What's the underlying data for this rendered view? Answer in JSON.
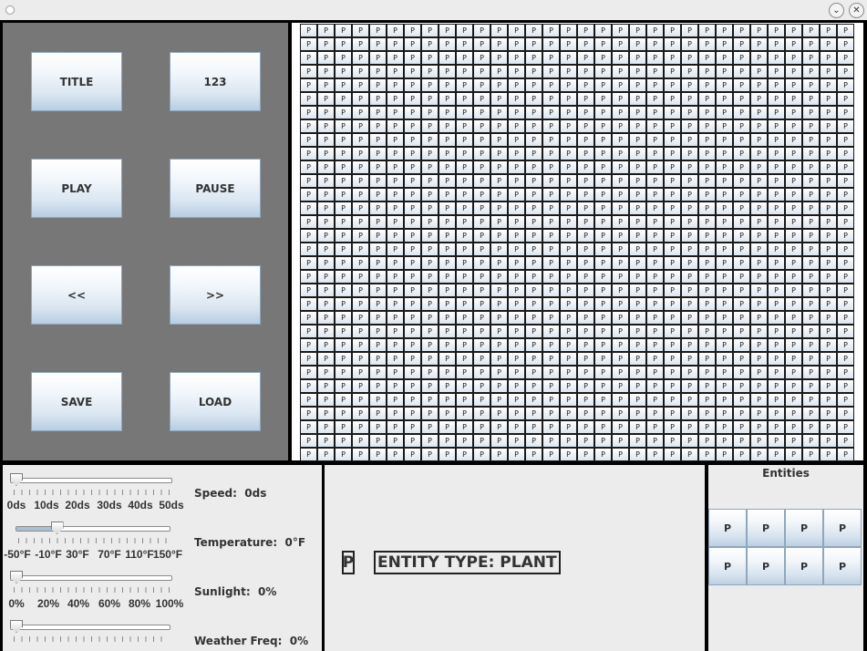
{
  "window": {
    "minimize_symbol": "⌄",
    "close_symbol": "✕"
  },
  "controls": {
    "title_label": "TITLE",
    "counter_label": "123",
    "play_label": "PLAY",
    "pause_label": "PAUSE",
    "rewind_label": "<<",
    "forward_label": ">>",
    "save_label": "SAVE",
    "load_label": "LOAD"
  },
  "grid": {
    "rows": 32,
    "cols": 32,
    "cell_label": "P"
  },
  "sliders": {
    "speed": {
      "label": "Speed:",
      "value": "0ds",
      "fraction": 0.0,
      "ticks": [
        "0ds",
        "10ds",
        "20ds",
        "30ds",
        "40ds",
        "50ds"
      ]
    },
    "temperature": {
      "label": "Temperature:",
      "value": "0°F",
      "fraction": 0.25,
      "ticks": [
        "-50°F",
        "-10°F",
        "30°F",
        "70°F",
        "110°F",
        "150°F"
      ]
    },
    "sunlight": {
      "label": "Sunlight:",
      "value": "0%",
      "fraction": 0.0,
      "ticks": [
        "0%",
        "20%",
        "40%",
        "60%",
        "80%",
        "100%"
      ]
    },
    "weather": {
      "label": "Weather Freq:",
      "value": "0%",
      "fraction": 0.0
    }
  },
  "info": {
    "entity_letter": "P",
    "entity_type": "ENTITY TYPE: PLANT"
  },
  "entities": {
    "title": "Entities",
    "items": [
      "P",
      "P",
      "P",
      "P",
      "P",
      "P",
      "P",
      "P"
    ]
  }
}
